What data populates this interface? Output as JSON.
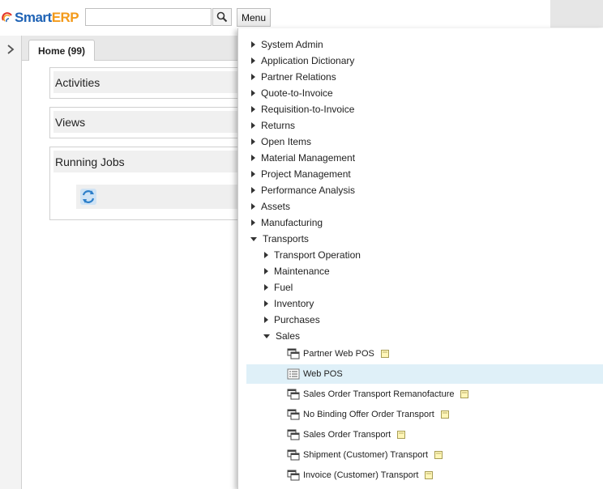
{
  "header": {
    "logo_smart": "Smart",
    "logo_erp": "ERP",
    "search_value": "",
    "menu_label": "Menu"
  },
  "home": {
    "tab_label": "Home (99)",
    "panels": [
      "Activities",
      "Views",
      "Running Jobs"
    ]
  },
  "menu": {
    "top_items": [
      "System Admin",
      "Application Dictionary",
      "Partner Relations",
      "Quote-to-Invoice",
      "Requisition-to-Invoice",
      "Returns",
      "Open Items",
      "Material Management",
      "Project Management",
      "Performance Analysis",
      "Assets",
      "Manufacturing"
    ],
    "open_item": "Transports",
    "sub_items": [
      "Transport Operation",
      "Maintenance",
      "Fuel",
      "Inventory",
      "Purchases"
    ],
    "open_sub_item": "Sales",
    "sales_items": [
      "Partner Web POS",
      "Web POS",
      "Sales Order Transport Remanofacture",
      "No Binding Offer Order Transport",
      "Sales Order Transport",
      "Shipment (Customer) Transport",
      "Invoice (Customer) Transport"
    ],
    "selected_item": "Web POS"
  },
  "colors": {
    "logo_blue": "#1f63b5",
    "logo_orange": "#f39a1b",
    "selected_row": "#dff0f8"
  }
}
